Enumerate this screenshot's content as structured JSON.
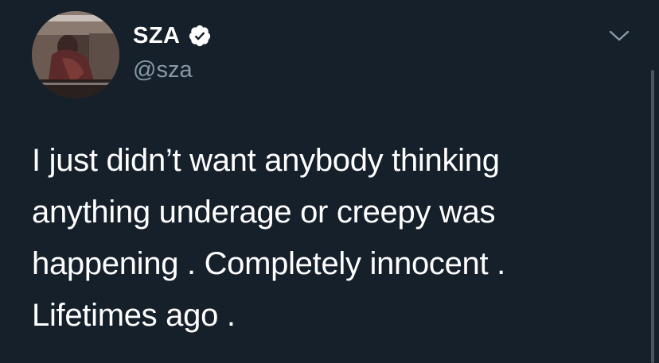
{
  "tweet": {
    "author": {
      "display_name": "SZA",
      "handle": "@sza",
      "verified": true,
      "avatar_icon": "profile-photo"
    },
    "text_lines": [
      "I just didn’t want anybody thinking",
      "anything underage or creepy was",
      "happening . Completely innocent .",
      "Lifetimes ago ."
    ],
    "menu_icon": "chevron-down-icon"
  },
  "colors": {
    "background": "#15202b",
    "primary_text": "#ffffff",
    "secondary_text": "#8899a6",
    "icon": "#8899a6"
  }
}
